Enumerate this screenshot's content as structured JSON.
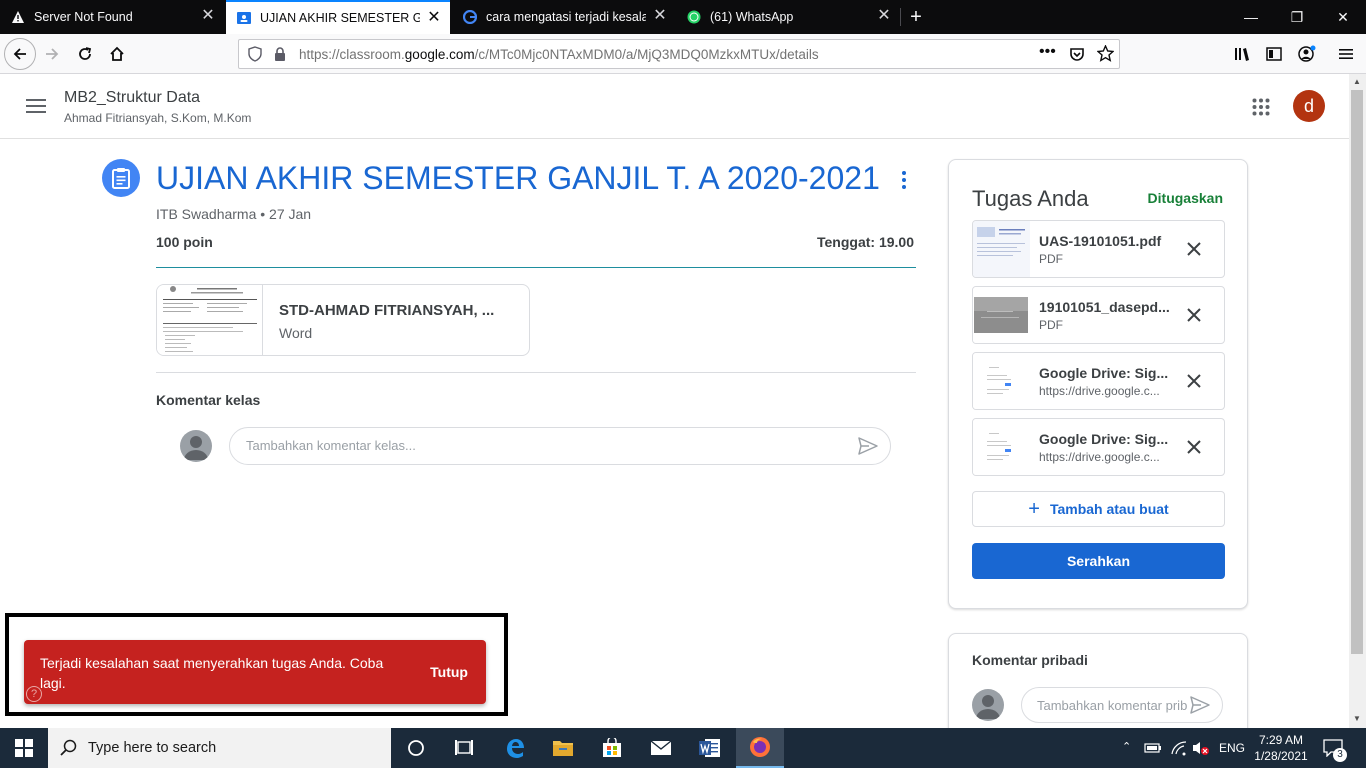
{
  "browser": {
    "tabs": [
      {
        "label": "Server Not Found",
        "icon": "warning-icon",
        "active": false
      },
      {
        "label": "UJIAN AKHIR SEMESTER GANJIL",
        "icon": "classroom-icon",
        "active": true
      },
      {
        "label": "cara mengatasi terjadi kesalaha",
        "icon": "google-icon",
        "active": false
      },
      {
        "label": "(61) WhatsApp",
        "icon": "whatsapp-icon",
        "active": false
      }
    ],
    "url_prefix": "https://classroom.",
    "url_domain": "google.com",
    "url_path": "/c/MTc0Mjc0NTAxMDM0/a/MjQ3MDQ0MzkxMTUx/details"
  },
  "header": {
    "class_name": "MB2_Struktur Data",
    "teacher": "Ahmad Fitriansyah, S.Kom, M.Kom",
    "avatar_letter": "d"
  },
  "assignment": {
    "title": "UJIAN AKHIR SEMESTER GANJIL T. A 2020-2021",
    "meta": "ITB Swadharma • 27 Jan",
    "points": "100 poin",
    "due": "Tenggat: 19.00",
    "attachment": {
      "name": "STD-AHMAD FITRIANSYAH, ...",
      "type": "Word"
    },
    "comments_label": "Komentar kelas",
    "comment_placeholder": "Tambahkan komentar kelas..."
  },
  "your_work": {
    "title": "Tugas Anda",
    "status": "Ditugaskan",
    "files": [
      {
        "name": "UAS-19101051.pdf",
        "sub": "PDF"
      },
      {
        "name": "19101051_dasepd...",
        "sub": "PDF"
      },
      {
        "name": "Google Drive: Sig...",
        "sub": "https://drive.google.c..."
      },
      {
        "name": "Google Drive: Sig...",
        "sub": "https://drive.google.c..."
      }
    ],
    "add_label": "Tambah atau buat",
    "submit_label": "Serahkan"
  },
  "private_comments": {
    "title": "Komentar pribadi",
    "placeholder": "Tambahkan komentar pribadi..."
  },
  "toast": {
    "message": "Terjadi kesalahan saat menyerahkan tugas Anda. Coba lagi.",
    "action": "Tutup"
  },
  "taskbar": {
    "search_placeholder": "Type here to search",
    "lang": "ENG",
    "time": "7:29 AM",
    "date": "1/28/2021",
    "notification_count": "3"
  },
  "colors": {
    "accent": "#1967d2",
    "error": "#c5221f",
    "status_green": "#188038",
    "avatar": "#b33410"
  }
}
